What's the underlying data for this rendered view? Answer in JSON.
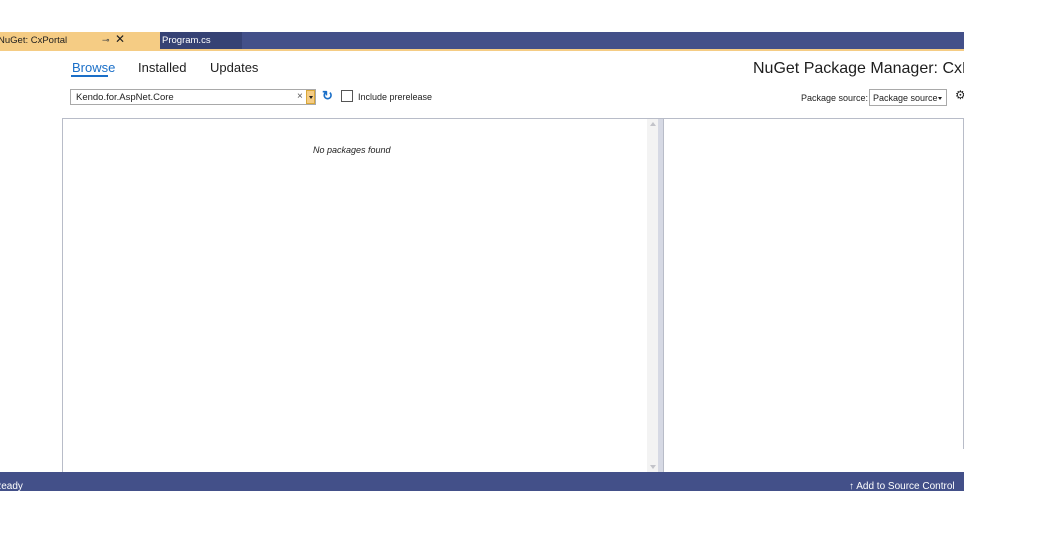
{
  "tabs": {
    "active": {
      "label": "NuGet: CxPortal",
      "pin_icon": "pin-icon",
      "close_icon": "close-icon"
    },
    "inactive": {
      "label": "Program.cs"
    }
  },
  "nav": {
    "browse": "Browse",
    "installed": "Installed",
    "updates": "Updates",
    "selected": "Browse"
  },
  "title": "NuGet Package Manager: CxPortal",
  "search": {
    "value": "Kendo.for.AspNet.Core",
    "clear_glyph": "×",
    "refresh_glyph": "↻"
  },
  "prerelease": {
    "label": "Include prerelease",
    "checked": false
  },
  "package_source": {
    "label": "Package source:",
    "value": "Package source"
  },
  "list": {
    "empty_message": "No packages found"
  },
  "status": {
    "text": "Ready",
    "source_control_glyph": "↑",
    "source_control_label": "Add to Source Control"
  },
  "colors": {
    "accent": "#1a6fc8",
    "tab_active": "#f5cc84",
    "chrome": "#435089"
  }
}
